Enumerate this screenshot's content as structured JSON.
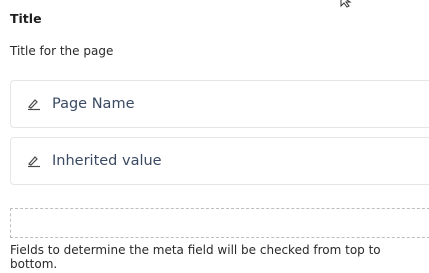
{
  "section": {
    "title": "Title",
    "description": "Title for the page"
  },
  "fields": [
    {
      "label": "Page Name",
      "icon": "edit-icon"
    },
    {
      "label": "Inherited value",
      "icon": "edit-icon"
    }
  ],
  "dropzone": {
    "label": ""
  },
  "hint": "Fields to determine the meta field will be checked from top to bottom.",
  "colors": {
    "label_text": "#3b4a63",
    "border": "#e6e6e6",
    "dashed_border": "#bdbdbd"
  }
}
